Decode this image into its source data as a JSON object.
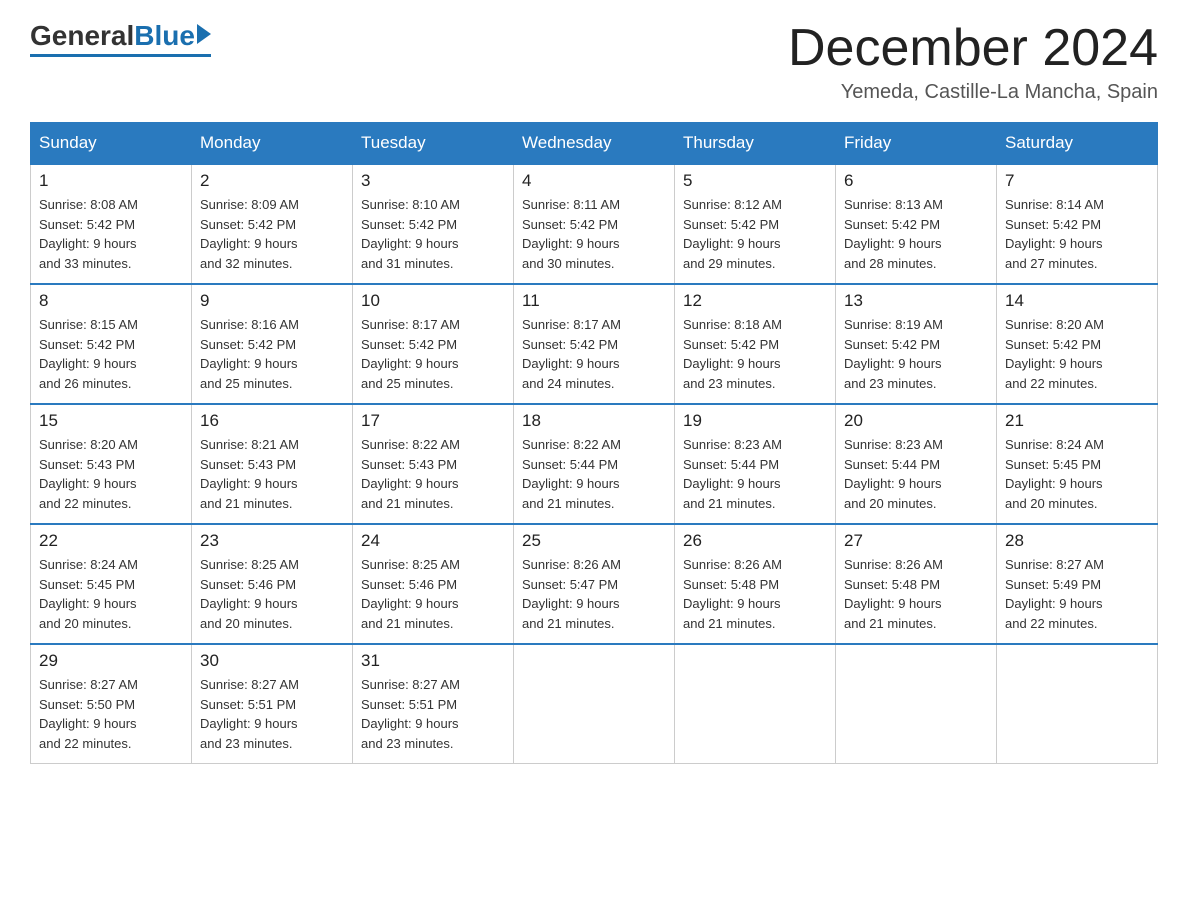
{
  "header": {
    "logo_general": "General",
    "logo_blue": "Blue",
    "month_title": "December 2024",
    "location": "Yemeda, Castille-La Mancha, Spain"
  },
  "weekdays": [
    "Sunday",
    "Monday",
    "Tuesday",
    "Wednesday",
    "Thursday",
    "Friday",
    "Saturday"
  ],
  "weeks": [
    [
      {
        "day": "1",
        "sunrise": "8:08 AM",
        "sunset": "5:42 PM",
        "daylight": "9 hours and 33 minutes."
      },
      {
        "day": "2",
        "sunrise": "8:09 AM",
        "sunset": "5:42 PM",
        "daylight": "9 hours and 32 minutes."
      },
      {
        "day": "3",
        "sunrise": "8:10 AM",
        "sunset": "5:42 PM",
        "daylight": "9 hours and 31 minutes."
      },
      {
        "day": "4",
        "sunrise": "8:11 AM",
        "sunset": "5:42 PM",
        "daylight": "9 hours and 30 minutes."
      },
      {
        "day": "5",
        "sunrise": "8:12 AM",
        "sunset": "5:42 PM",
        "daylight": "9 hours and 29 minutes."
      },
      {
        "day": "6",
        "sunrise": "8:13 AM",
        "sunset": "5:42 PM",
        "daylight": "9 hours and 28 minutes."
      },
      {
        "day": "7",
        "sunrise": "8:14 AM",
        "sunset": "5:42 PM",
        "daylight": "9 hours and 27 minutes."
      }
    ],
    [
      {
        "day": "8",
        "sunrise": "8:15 AM",
        "sunset": "5:42 PM",
        "daylight": "9 hours and 26 minutes."
      },
      {
        "day": "9",
        "sunrise": "8:16 AM",
        "sunset": "5:42 PM",
        "daylight": "9 hours and 25 minutes."
      },
      {
        "day": "10",
        "sunrise": "8:17 AM",
        "sunset": "5:42 PM",
        "daylight": "9 hours and 25 minutes."
      },
      {
        "day": "11",
        "sunrise": "8:17 AM",
        "sunset": "5:42 PM",
        "daylight": "9 hours and 24 minutes."
      },
      {
        "day": "12",
        "sunrise": "8:18 AM",
        "sunset": "5:42 PM",
        "daylight": "9 hours and 23 minutes."
      },
      {
        "day": "13",
        "sunrise": "8:19 AM",
        "sunset": "5:42 PM",
        "daylight": "9 hours and 23 minutes."
      },
      {
        "day": "14",
        "sunrise": "8:20 AM",
        "sunset": "5:42 PM",
        "daylight": "9 hours and 22 minutes."
      }
    ],
    [
      {
        "day": "15",
        "sunrise": "8:20 AM",
        "sunset": "5:43 PM",
        "daylight": "9 hours and 22 minutes."
      },
      {
        "day": "16",
        "sunrise": "8:21 AM",
        "sunset": "5:43 PM",
        "daylight": "9 hours and 21 minutes."
      },
      {
        "day": "17",
        "sunrise": "8:22 AM",
        "sunset": "5:43 PM",
        "daylight": "9 hours and 21 minutes."
      },
      {
        "day": "18",
        "sunrise": "8:22 AM",
        "sunset": "5:44 PM",
        "daylight": "9 hours and 21 minutes."
      },
      {
        "day": "19",
        "sunrise": "8:23 AM",
        "sunset": "5:44 PM",
        "daylight": "9 hours and 21 minutes."
      },
      {
        "day": "20",
        "sunrise": "8:23 AM",
        "sunset": "5:44 PM",
        "daylight": "9 hours and 20 minutes."
      },
      {
        "day": "21",
        "sunrise": "8:24 AM",
        "sunset": "5:45 PM",
        "daylight": "9 hours and 20 minutes."
      }
    ],
    [
      {
        "day": "22",
        "sunrise": "8:24 AM",
        "sunset": "5:45 PM",
        "daylight": "9 hours and 20 minutes."
      },
      {
        "day": "23",
        "sunrise": "8:25 AM",
        "sunset": "5:46 PM",
        "daylight": "9 hours and 20 minutes."
      },
      {
        "day": "24",
        "sunrise": "8:25 AM",
        "sunset": "5:46 PM",
        "daylight": "9 hours and 21 minutes."
      },
      {
        "day": "25",
        "sunrise": "8:26 AM",
        "sunset": "5:47 PM",
        "daylight": "9 hours and 21 minutes."
      },
      {
        "day": "26",
        "sunrise": "8:26 AM",
        "sunset": "5:48 PM",
        "daylight": "9 hours and 21 minutes."
      },
      {
        "day": "27",
        "sunrise": "8:26 AM",
        "sunset": "5:48 PM",
        "daylight": "9 hours and 21 minutes."
      },
      {
        "day": "28",
        "sunrise": "8:27 AM",
        "sunset": "5:49 PM",
        "daylight": "9 hours and 22 minutes."
      }
    ],
    [
      {
        "day": "29",
        "sunrise": "8:27 AM",
        "sunset": "5:50 PM",
        "daylight": "9 hours and 22 minutes."
      },
      {
        "day": "30",
        "sunrise": "8:27 AM",
        "sunset": "5:51 PM",
        "daylight": "9 hours and 23 minutes."
      },
      {
        "day": "31",
        "sunrise": "8:27 AM",
        "sunset": "5:51 PM",
        "daylight": "9 hours and 23 minutes."
      },
      null,
      null,
      null,
      null
    ]
  ]
}
